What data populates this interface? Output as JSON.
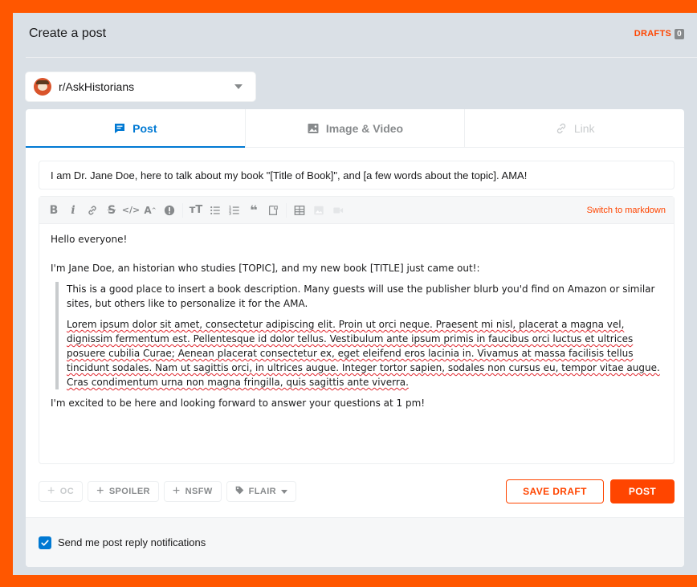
{
  "header": {
    "title": "Create a post",
    "drafts_label": "DRAFTS",
    "drafts_count": "0"
  },
  "community": {
    "name": "r/AskHistorians"
  },
  "tabs": [
    {
      "label": "Post",
      "icon": "post-icon",
      "state": "active"
    },
    {
      "label": "Image & Video",
      "icon": "image-icon",
      "state": "normal"
    },
    {
      "label": "Link",
      "icon": "link-icon",
      "state": "disabled"
    }
  ],
  "post": {
    "title": "I am Dr. Jane Doe, here to talk about my book \"[Title of Book]\", and [a few words about the topic]. AMA!"
  },
  "editor": {
    "switch_label": "Switch to markdown",
    "toolbar_icons": [
      "bold-icon",
      "italic-icon",
      "link-icon",
      "strikethrough-icon",
      "inline-code-icon",
      "superscript-icon",
      "spoiler-icon",
      "heading-icon",
      "bulleted-list-icon",
      "numbered-list-icon",
      "quote-icon",
      "code-block-icon",
      "table-icon",
      "image-icon",
      "video-icon"
    ],
    "para1": "Hello everyone!",
    "para2": "I'm Jane Doe, an historian who studies [TOPIC], and my new book [TITLE] just came out!:",
    "quote1": "This is a good place to insert a book description. Many guests will use the publisher blurb you'd find on Amazon or similar sites, but others like to personalize it for the AMA.",
    "quote2": "Lorem ipsum dolor sit amet, consectetur adipiscing elit. Proin ut orci neque. Praesent mi nisl, placerat a magna vel, dignissim fermentum est. Pellentesque id dolor tellus. Vestibulum ante ipsum primis in faucibus orci luctus et ultrices posuere cubilia Curae; Aenean placerat consectetur ex, eget eleifend eros lacinia in. Vivamus at massa facilisis tellus tincidunt sodales. Nam ut sagittis orci, in ultrices augue. Integer tortor sapien, sodales non cursus eu, tempor vitae augue. Cras condimentum urna non magna fringilla, quis sagittis ante viverra.",
    "para3": "I'm excited to be here and looking forward to answer your questions at 1 pm!"
  },
  "tags": {
    "oc": "OC",
    "spoiler": "SPOILER",
    "nsfw": "NSFW",
    "flair": "FLAIR"
  },
  "actions": {
    "save_draft": "SAVE DRAFT",
    "post": "POST"
  },
  "footer": {
    "notify_label": "Send me post reply notifications",
    "notify_checked": true
  },
  "colors": {
    "accent": "#ff4500",
    "link_blue": "#0079d3",
    "frame": "#ff5700"
  }
}
